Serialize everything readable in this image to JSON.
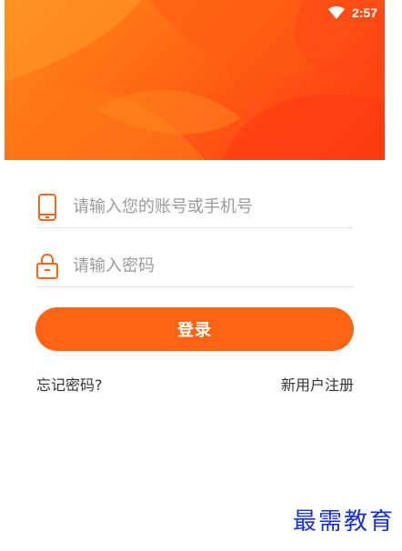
{
  "status_bar": {
    "time": "2:57",
    "wifi_icon": "wifi-icon"
  },
  "colors": {
    "accent": "#ff6414",
    "header_start": "#ff8a1c",
    "header_end": "#ff3d10",
    "watermark": "#1a2fd6"
  },
  "form": {
    "account": {
      "placeholder": "请输入您的账号或手机号",
      "value": "",
      "icon": "phone-icon"
    },
    "password": {
      "placeholder": "请输入密码",
      "value": "",
      "icon": "lock-icon"
    },
    "login_label": "登录",
    "forgot_label": "忘记密码?",
    "register_label": "新用户注册"
  },
  "watermark": "最需教育"
}
